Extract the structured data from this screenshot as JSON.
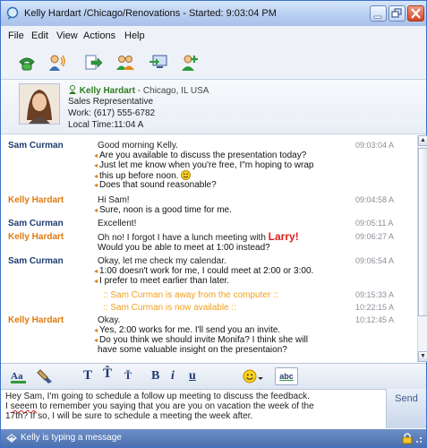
{
  "window": {
    "title": "Kelly Hardart /Chicago/Renovations - Started: 9:03:04 PM"
  },
  "menu": [
    "File",
    "Edit",
    "View",
    "Actions",
    "Help"
  ],
  "toolbar": [
    "phone-icon",
    "voice-icon",
    "send-file-icon",
    "group-icon",
    "screen-share-icon",
    "add-contact-icon"
  ],
  "contact": {
    "name": "Kelly Hardart",
    "location": " - Chicago, IL USA",
    "title": "Sales Representative",
    "work": "Work: (617) 555-6782",
    "local_time": "Local Time:11:04 A"
  },
  "messages": [
    {
      "sender": "Sam Curman",
      "lines": [
        "Good morning Kelly."
      ],
      "time": "09:03:04 A"
    },
    {
      "sender": "",
      "lines": [
        "Are you available to discuss the presentation today?"
      ],
      "time": ""
    },
    {
      "sender": "",
      "lines": [
        "Just let me know when you're free, I\"m hoping to wrap"
      ],
      "time": ""
    },
    {
      "sender": "",
      "lines": [
        "this up before noon."
      ],
      "time": ""
    },
    {
      "sender": "",
      "lines": [
        "Does that sound reasonable?"
      ],
      "time": ""
    },
    {
      "sender": "Kelly Hardart",
      "lines": [
        "Hi Sam!"
      ],
      "time": "09:04:58 A"
    },
    {
      "sender": "",
      "lines": [
        "Sure, noon is a good time for me."
      ],
      "time": ""
    },
    {
      "sender": "Sam Curman",
      "lines": [
        "Excellent!"
      ],
      "time": "09:05:11 A"
    },
    {
      "sender": "Kelly Hardart",
      "lines": [
        "Oh no! I forgot I have a lunch meeting with "
      ],
      "time": "09:06:27 A"
    },
    {
      "sender": "",
      "lines": [
        "Would you be able to meet at 1:00 instead?"
      ],
      "time": ""
    },
    {
      "sender": "Sam Curman",
      "lines": [
        "Okay, let me check my calendar."
      ],
      "time": "09:06:54 A"
    },
    {
      "sender": "",
      "lines": [
        "1:00 doesn't work for me, I could meet at 2:00 or 3:00."
      ],
      "time": ""
    },
    {
      "sender": "",
      "lines": [
        "I prefer to meet earlier than later."
      ],
      "time": ""
    },
    {
      "sender": "",
      "lines": [
        ":: Sam Curman is away from the computer ::"
      ],
      "time": "09:15:33 A"
    },
    {
      "sender": "",
      "lines": [
        ":: Sam Curman is now available ::"
      ],
      "time": "10:22:15 A"
    },
    {
      "sender": "Kelly Hardart",
      "lines": [
        "Okay."
      ],
      "time": "10:12:45 A"
    },
    {
      "sender": "",
      "lines": [
        "Yes, 2:00 works for me. I'll send you an invite."
      ],
      "time": ""
    },
    {
      "sender": "",
      "lines": [
        "Do you think we should invite Monifa? I think she will"
      ],
      "time": ""
    },
    {
      "sender": "",
      "lines": [
        "have some valuable insight on the presentaion?"
      ],
      "time": ""
    }
  ],
  "larry": "Larry!",
  "compose": {
    "l1": "Hey Sam, I'm going to schedule a follow up meeting to discuss the feedback.",
    "l2a": "I ",
    "l2b": "seeem",
    "l2c": " to remember you saying that you are you on vacation the week of the",
    "l3": "17th? If so, I will be sure to schedule a meeting the week after."
  },
  "send_label": "Send",
  "status": "Kelly is typing a message",
  "format_buttons": [
    "font-color-icon",
    "highlight-icon",
    "text-normal-icon",
    "text-larger-icon",
    "text-smaller-icon",
    "bold-icon",
    "italic-icon",
    "underline-icon",
    "emoticon-icon",
    "spellcheck-icon"
  ],
  "format_text": {
    "b": "B",
    "i": "i",
    "u": "u",
    "abc": "abc"
  }
}
